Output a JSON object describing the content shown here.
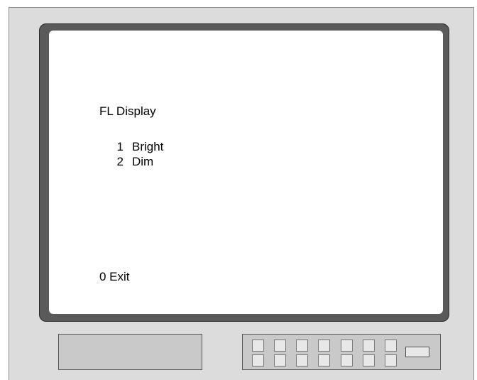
{
  "screen": {
    "title": "FL Display",
    "options": [
      {
        "number": "1",
        "label": "Bright"
      },
      {
        "number": "2",
        "label": "Dim"
      }
    ],
    "exit_label": "0 Exit"
  },
  "colors": {
    "case": "#dcdcdc",
    "bezel": "#5a5a5a",
    "screen": "#ffffff",
    "panel": "#c9c9c9"
  }
}
